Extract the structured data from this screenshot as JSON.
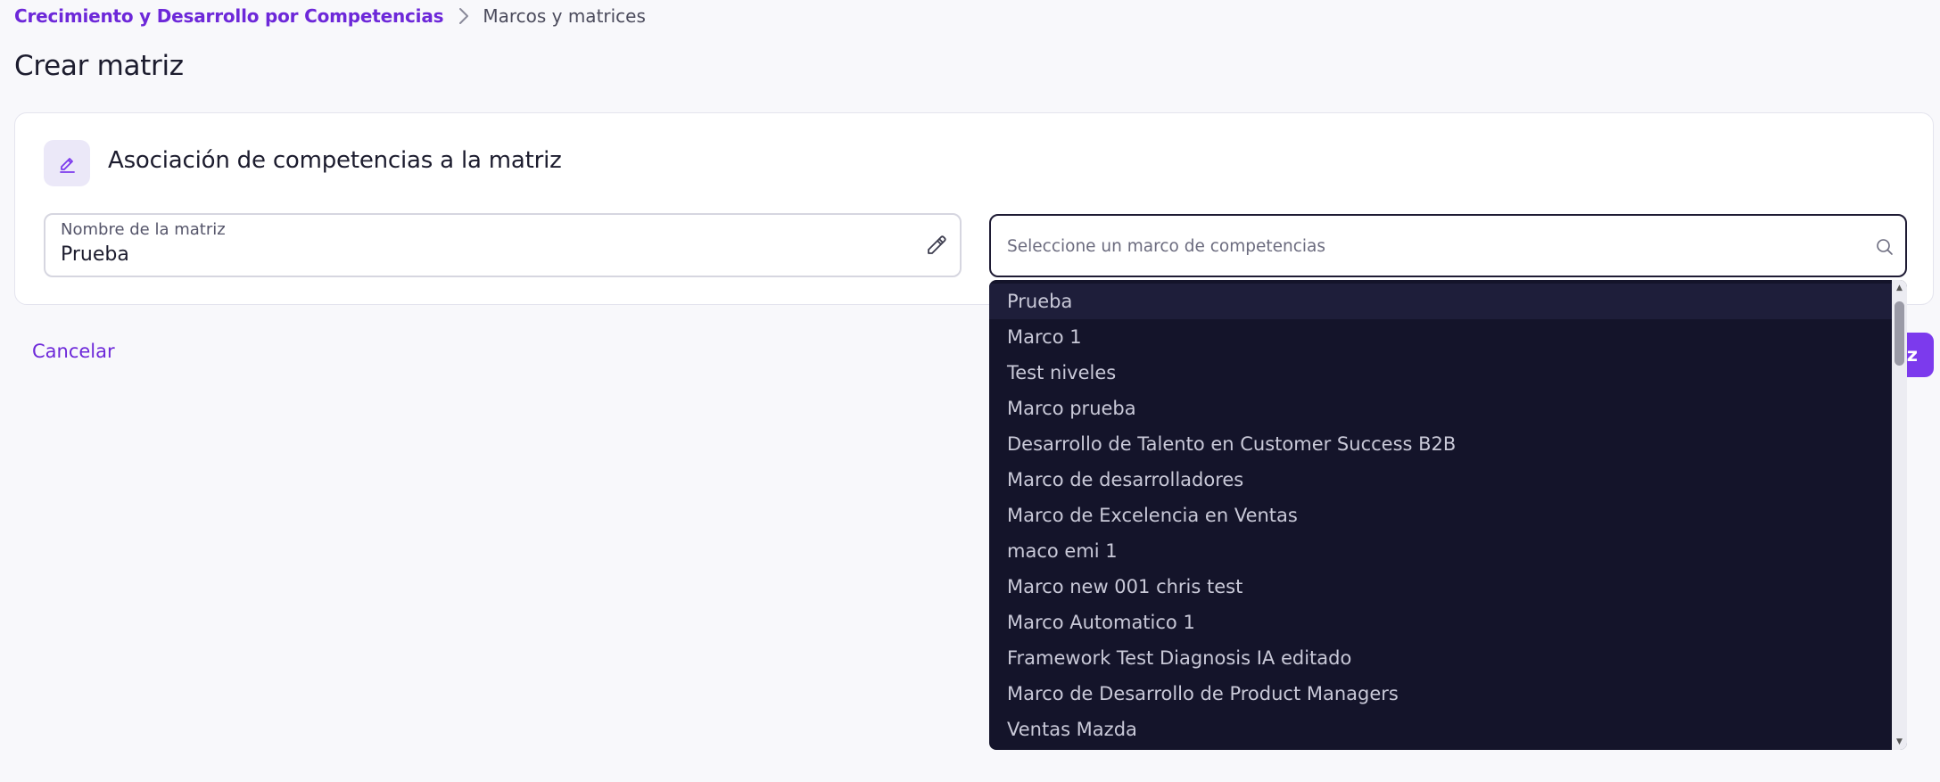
{
  "breadcrumb": {
    "parent": "Crecimiento y Desarrollo por Competencias",
    "current": "Marcos y matrices"
  },
  "page": {
    "title": "Crear matriz"
  },
  "card": {
    "heading": "Asociación de competencias a la matriz",
    "name_field": {
      "label": "Nombre de la matriz",
      "value": "Prueba"
    },
    "framework_select": {
      "placeholder": "Seleccione un marco de competencias"
    }
  },
  "actions": {
    "cancel_label": "Cancelar",
    "create_label_visible": "z"
  },
  "dropdown": {
    "options": [
      "Prueba",
      "Marco 1",
      "Test niveles",
      "Marco prueba",
      "Desarrollo de Talento en Customer Success B2B",
      "Marco de desarrolladores",
      "Marco de Excelencia en Ventas",
      "maco emi 1",
      "Marco new 001 chris test",
      "Marco Automatico 1",
      "Framework Test Diagnosis IA editado",
      "Marco de Desarrollo de Product Managers",
      "Ventas Mazda"
    ],
    "highlighted_index": 0
  },
  "colors": {
    "brand": "#7c3aed",
    "link": "#6d28d9",
    "dropdown_bg": "#14142a",
    "page_bg": "#f8f8fb"
  },
  "icons": {
    "breadcrumb_separator": "chevron-right-icon",
    "card_icon": "edit-icon",
    "name_field_action": "pencil-icon",
    "select_action": "search-icon"
  }
}
